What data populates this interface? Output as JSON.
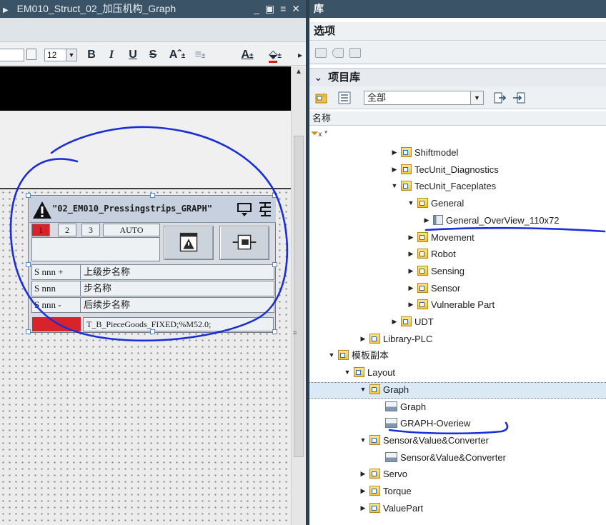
{
  "editor": {
    "title": "EM010_Struct_02_加压机构_Graph",
    "window_controls": [
      "_",
      "▣",
      "≡",
      "✕"
    ],
    "format_toolbar": {
      "font_size": "12",
      "bold": "B",
      "italic": "I",
      "underline": "U",
      "strike": "S",
      "font_color": "A"
    },
    "faceplate": {
      "name": "\"02_EM010_Pressingstrips_GRAPH\"",
      "steps": [
        "1",
        "2",
        "3"
      ],
      "mode": "AUTO",
      "rows": [
        {
          "code": "S nnn +",
          "label": "上级步名称"
        },
        {
          "code": "S nnn",
          "label": "步名称"
        },
        {
          "code": "S nnn -",
          "label": "后续步名称"
        }
      ],
      "tag": "T_B_PieceGoods_FIXED;%M52.0;",
      "active_step_color": "#d9232b"
    }
  },
  "library": {
    "title": "库",
    "options_label": "选项",
    "project_library_label": "项目库",
    "filter_value": "全部",
    "column_name": "名称",
    "filter_symbol": "*",
    "tree": [
      {
        "label": "Shiftmodel",
        "level": 5,
        "toggle": "▶",
        "icon": "folder"
      },
      {
        "label": "TecUnit_Diagnostics",
        "level": 5,
        "toggle": "▶",
        "icon": "folder"
      },
      {
        "label": "TecUnit_Faceplates",
        "level": 5,
        "toggle": "▼",
        "icon": "folder"
      },
      {
        "label": "General",
        "level": 6,
        "toggle": "▼",
        "icon": "folder"
      },
      {
        "label": "General_OverView_110x72",
        "level": 7,
        "toggle": "▶",
        "icon": "block"
      },
      {
        "label": "Movement",
        "level": 6,
        "toggle": "▶",
        "icon": "folder"
      },
      {
        "label": "Robot",
        "level": 6,
        "toggle": "▶",
        "icon": "folder"
      },
      {
        "label": "Sensing",
        "level": 6,
        "toggle": "▶",
        "icon": "folder"
      },
      {
        "label": "Sensor",
        "level": 6,
        "toggle": "▶",
        "icon": "folder"
      },
      {
        "label": "Vulnerable Part",
        "level": 6,
        "toggle": "▶",
        "icon": "folder"
      },
      {
        "label": "UDT",
        "level": 5,
        "toggle": "▶",
        "icon": "folder"
      },
      {
        "label": "Library-PLC",
        "level": 3,
        "toggle": "▶",
        "icon": "folder"
      },
      {
        "label": "模板副本",
        "level": 1,
        "toggle": "▼",
        "icon": "folder"
      },
      {
        "label": "Layout",
        "level": 2,
        "toggle": "▼",
        "icon": "folder"
      },
      {
        "label": "Graph",
        "level": 3,
        "toggle": "▼",
        "icon": "folder",
        "selected": true
      },
      {
        "label": "Graph",
        "level": 4,
        "toggle": "",
        "icon": "graphic"
      },
      {
        "label": "GRAPH-Overiew",
        "level": 4,
        "toggle": "",
        "icon": "graphic"
      },
      {
        "label": "Sensor&Value&Converter",
        "level": 3,
        "toggle": "▼",
        "icon": "folder"
      },
      {
        "label": "Sensor&Value&Converter",
        "level": 4,
        "toggle": "",
        "icon": "graphic"
      },
      {
        "label": "Servo",
        "level": 3,
        "toggle": "▶",
        "icon": "folder"
      },
      {
        "label": "Torque",
        "level": 3,
        "toggle": "▶",
        "icon": "folder"
      },
      {
        "label": "ValuePart",
        "level": 3,
        "toggle": "▶",
        "icon": "folder"
      }
    ]
  },
  "colors": {
    "title_bar": "#3a5366",
    "annotation_ink": "#1a2fd8",
    "selection": "#dbe8f6"
  }
}
